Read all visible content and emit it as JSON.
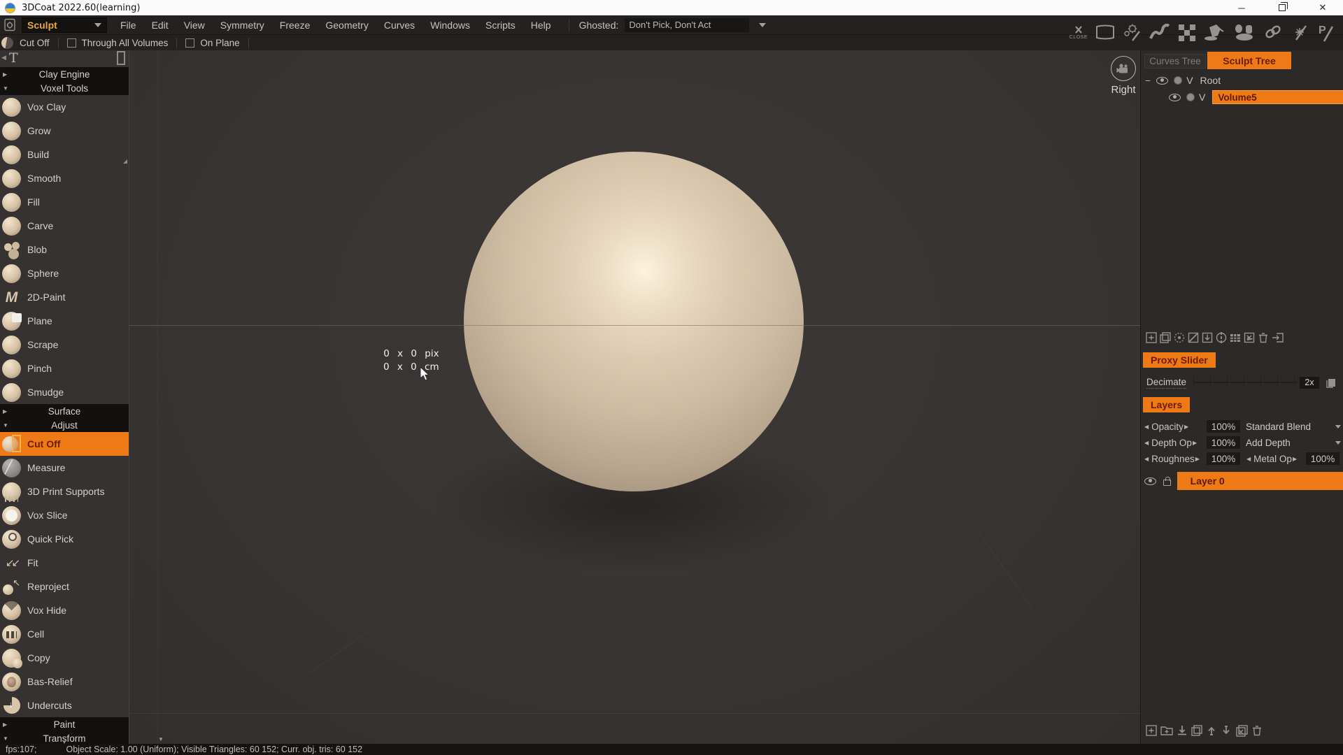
{
  "window": {
    "title": "3DCoat 2022.60(learning)",
    "minimize": "─",
    "close_x": "✕"
  },
  "menubar": {
    "room": "Sculpt",
    "items": [
      "File",
      "Edit",
      "View",
      "Symmetry",
      "Freeze",
      "Geometry",
      "Curves",
      "Windows",
      "Scripts",
      "Help"
    ],
    "ghosted_label": "Ghosted:",
    "ghosted_value": "Don't Pick, Don't Act"
  },
  "toolbar": {
    "tool": "Cut Off",
    "check1": "Through All Volumes",
    "check2": "On Plane",
    "close_label": "CLOSE"
  },
  "sidebar": {
    "headers": {
      "clay": "Clay Engine",
      "voxel": "Voxel Tools",
      "surface": "Surface",
      "adjust": "Adjust",
      "paint": "Paint",
      "transform": "Transform"
    },
    "voxel_tools": [
      "Vox Clay",
      "Grow",
      "Build",
      "Smooth",
      "Fill",
      "Carve",
      "Blob",
      "Sphere",
      "2D-Paint",
      "Plane",
      "Scrape",
      "Pinch",
      "Smudge"
    ],
    "adjust_tools": [
      "Cut Off",
      "Measure",
      "3D Print Supports",
      "Vox Slice",
      "Quick Pick",
      "Fit",
      "Reproject",
      "Vox Hide",
      "Cell",
      "Copy",
      "Bas-Relief",
      "Undercuts"
    ],
    "selected_tool": "Cut Off"
  },
  "viewport": {
    "size_pix": "0 x 0 pix",
    "size_cm": "0 x 0 cm",
    "view_label": "Right"
  },
  "sculpt_tree": {
    "tab_curves": "Curves Tree",
    "tab_sculpt": "Sculpt Tree",
    "root": "Root",
    "volume": "Volume5",
    "v": "V"
  },
  "proxy": {
    "tab": "Proxy Slider",
    "decimate": "Decimate",
    "value": "2x"
  },
  "layers": {
    "tab": "Layers",
    "opacity": "Opacity",
    "opacity_val": "100%",
    "blend": "Standard Blend",
    "depth": "Depth Op",
    "depth_val": "100%",
    "depth_blend": "Add Depth",
    "rough": "Roughnes",
    "rough_val": "100%",
    "metal": "Metal Op",
    "metal_val": "100%",
    "layer": "Layer 0"
  },
  "statusbar": {
    "fps": "fps:107;",
    "info": "Object Scale: 1.00 (Uniform); Visible Triangles: 60 152; Curr. obj. tris: 60 152"
  },
  "glyphs": {
    "collapsed": "▶",
    "expanded": "▼",
    "left": "◀",
    "right": "▶",
    "minus": "−",
    "t": "T",
    "down": "▼",
    "m": "M",
    "fit": "↙↙",
    "reproject_arrow": "↖",
    "undercut_arrow": "↓",
    "measure_line": "╱",
    "build_corner": "◢"
  },
  "colors": {
    "accent": "#ee7a16",
    "accent_text": "#6b1c00",
    "sphere_base": "#d5c3ab"
  }
}
